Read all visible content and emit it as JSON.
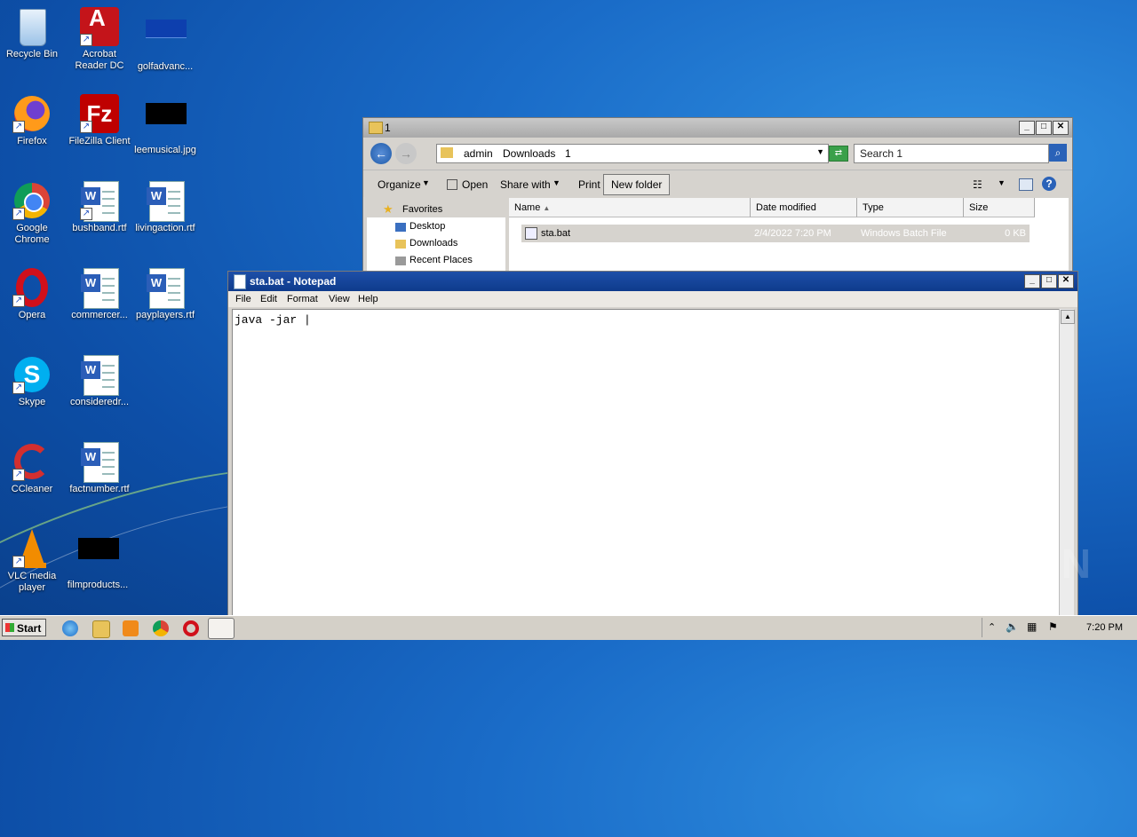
{
  "desktop": {
    "icons": [
      {
        "label": "Recycle Bin"
      },
      {
        "label": "Acrobat Reader DC"
      },
      {
        "label": "golfadvanc..."
      },
      {
        "label": "Firefox"
      },
      {
        "label": "FileZilla Client"
      },
      {
        "label": "leemusical.jpg"
      },
      {
        "label": "Google Chrome"
      },
      {
        "label": "bushband.rtf"
      },
      {
        "label": "livingaction.rtf"
      },
      {
        "label": "Opera"
      },
      {
        "label": "commercer..."
      },
      {
        "label": "payplayers.rtf"
      },
      {
        "label": "Skype"
      },
      {
        "label": "consideredr..."
      },
      {
        "label": "CCleaner"
      },
      {
        "label": "factnumber.rtf"
      },
      {
        "label": "VLC media player"
      },
      {
        "label": "filmproducts..."
      }
    ]
  },
  "explorer": {
    "title": "1",
    "breadcrumb": [
      "admin",
      "Downloads",
      "1"
    ],
    "search_placeholder": "Search 1",
    "toolbar": {
      "organize": "Organize",
      "open": "Open",
      "share_with": "Share with",
      "print": "Print",
      "new_folder": "New folder"
    },
    "nav": {
      "favorites": "Favorites",
      "desktop": "Desktop",
      "downloads": "Downloads",
      "recent_places": "Recent Places"
    },
    "columns": {
      "name": "Name",
      "date_modified": "Date modified",
      "type": "Type",
      "size": "Size"
    },
    "files": [
      {
        "name": "sta.bat",
        "date": "2/4/2022 7:20 PM",
        "type": "Windows Batch File",
        "size": "0 KB"
      }
    ]
  },
  "notepad": {
    "title": "sta.bat - Notepad",
    "menu": [
      "File",
      "Edit",
      "Format",
      "View",
      "Help"
    ],
    "content": "java -jar |"
  },
  "taskbar": {
    "start": "Start",
    "clock": "7:20 PM"
  },
  "watermark": "ANY RUN",
  "colors": {
    "accent": "#0e3b8c",
    "desktop": "#1a6cc8"
  }
}
